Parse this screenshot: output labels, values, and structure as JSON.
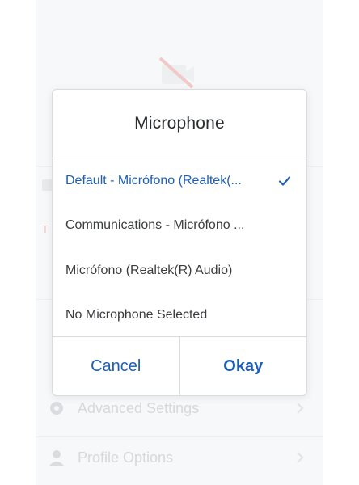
{
  "background": {
    "rows": [
      {
        "label": "Advanced Settings",
        "icon": "gear-icon"
      },
      {
        "label": "Profile Options",
        "icon": "person-icon"
      }
    ],
    "red_text": "T"
  },
  "dialog": {
    "title": "Microphone",
    "options": [
      {
        "label": "Default - Micrófono (Realtek(...",
        "selected": true
      },
      {
        "label": "Communications - Micrófono ...",
        "selected": false
      },
      {
        "label": "Micrófono (Realtek(R) Audio)",
        "selected": false
      },
      {
        "label": "No Microphone Selected",
        "selected": false
      }
    ],
    "cancel_label": "Cancel",
    "okay_label": "Okay"
  },
  "colors": {
    "accent": "#1e5fb5",
    "text": "#3a3c3e",
    "divider": "#d9dbde"
  }
}
